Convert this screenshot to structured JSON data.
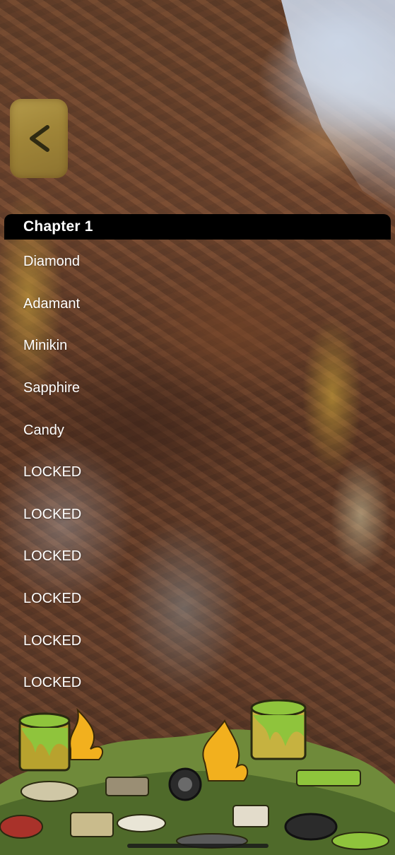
{
  "navigation": {
    "back_icon": "chevron-left-icon"
  },
  "chapter": {
    "title": "Chapter 1"
  },
  "levels": [
    {
      "label": "Diamond"
    },
    {
      "label": "Adamant"
    },
    {
      "label": "Minikin"
    },
    {
      "label": "Sapphire"
    },
    {
      "label": "Candy"
    },
    {
      "label": "LOCKED"
    },
    {
      "label": "LOCKED"
    },
    {
      "label": "LOCKED"
    },
    {
      "label": "LOCKED"
    },
    {
      "label": "LOCKED"
    },
    {
      "label": "LOCKED"
    }
  ],
  "colors": {
    "header_background": "#000000",
    "text": "#ffffff",
    "back_button": "#a08538",
    "back_chevron": "#2f2a12"
  }
}
